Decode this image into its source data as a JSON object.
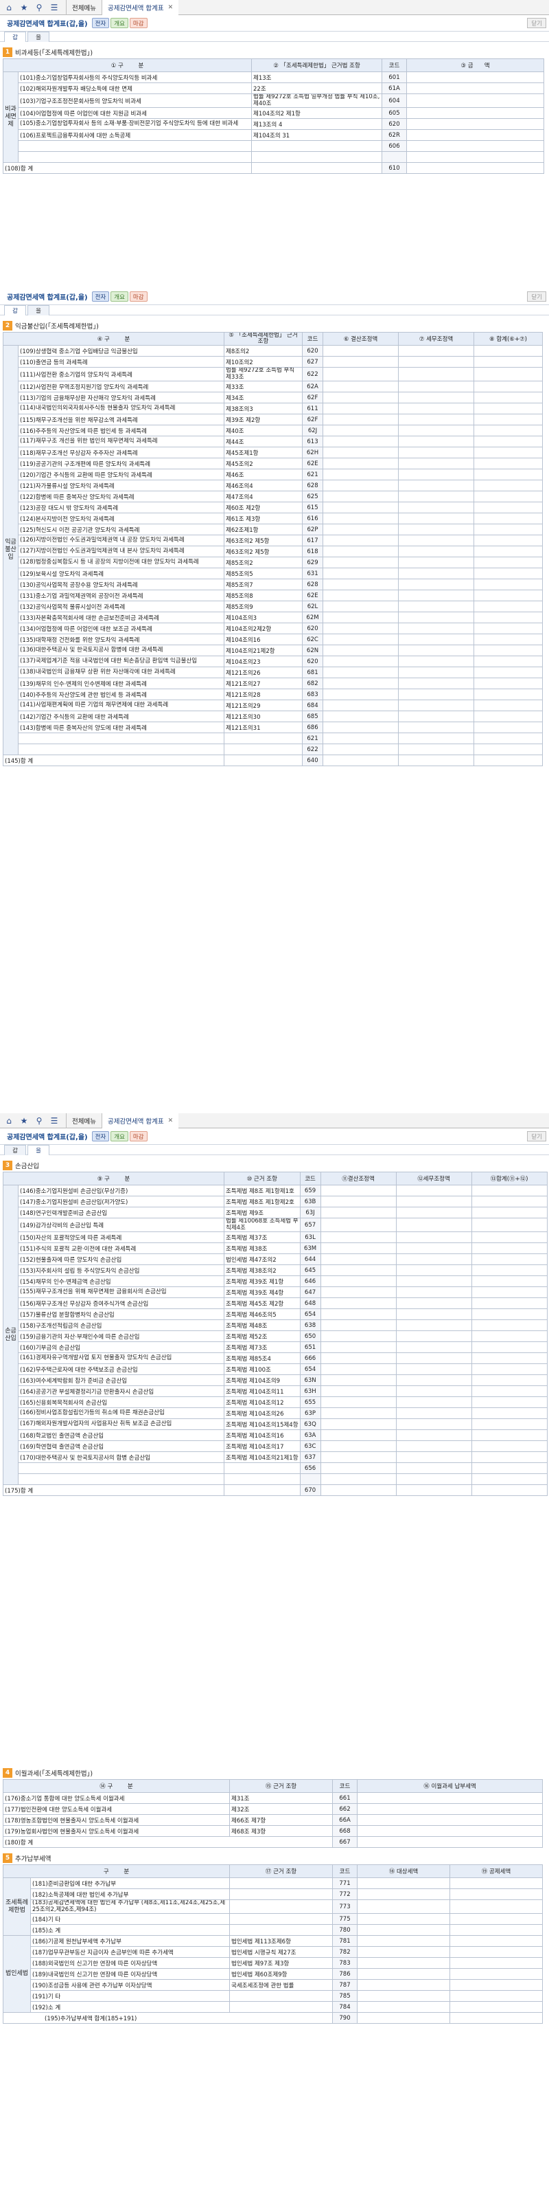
{
  "tabbar": {
    "menu_tab": "전체메뉴",
    "active_tab": "공제감면세액 합계표"
  },
  "form1": {
    "title": "공제감면세액 합계표(갑,을)",
    "btn_print": "전자",
    "btn_open": "개요",
    "btn_close": "마감",
    "btn_exit": "닫기",
    "tab_a": "갑",
    "tab_b": "을",
    "section_no": "1",
    "section_title": "비과세등(「조세특례제한법」)",
    "headers": {
      "gubun": "① 구",
      "gubun2": "분",
      "basis": "② 「조세특례제한법」 근거법 조항",
      "code": "코드",
      "amount": "③ 금",
      "amount2": "액"
    },
    "group": "비과세면제",
    "rows": [
      {
        "name": "(101)중소기업창업투자회사등의 주식양도차익등 비과세",
        "basis": "제13조",
        "code": "601"
      },
      {
        "name": "(102)해외자원개발투자 배당소득에 대한 면제",
        "basis": "22조",
        "code": "61A"
      },
      {
        "name": "(103)기업구조조정전문회사등의 양도차익 비과세",
        "basis": "법률 제9272호 조특법 일부개정 법률 부칙 제10조,제40조",
        "code": "604"
      },
      {
        "name": "(104)어업협정에 따른 어업인에 대한 지원금 비과세",
        "basis": "제104조의2 제1항",
        "code": "605"
      },
      {
        "name": "(105)중소기업창업투자회사 등의 소재·부품·장비전문기업 주식양도차익 등에 대한 비과세",
        "basis": "제13조의 4",
        "code": "620"
      },
      {
        "name": "(106)프로젝트금융투자회사에 대한 소득공제",
        "basis": "제104조의 31",
        "code": "62R"
      },
      {
        "name": "",
        "basis": "",
        "code": "606"
      },
      {
        "name": "",
        "basis": "",
        "code": ""
      }
    ],
    "total": {
      "name": "(108)합      계",
      "code": "610"
    }
  },
  "form2": {
    "section_no": "2",
    "section_title": "익금불산입(「조세특례제한법」)",
    "headers": {
      "gubun": "④ 구",
      "gubun2": "분",
      "basis": "⑤ 「조세특례제한법」 근거 조항",
      "code": "코드",
      "c1": "⑥ 결산조정액",
      "c2": "⑦ 세무조정액",
      "c3": "⑧ 합계(⑥+⑦)"
    },
    "group": "익금불산입",
    "rows": [
      {
        "name": "(109)상생협력 중소기업 수입배당금 익금불산입",
        "basis": "제8조의2",
        "code": "620"
      },
      {
        "name": "(110)출연금 등의 과세특례",
        "basis": "제10조의2",
        "code": "627"
      },
      {
        "name": "(111)사업전환 중소기업의 양도차익 과세특례",
        "basis": "법률 제9272호 조특법 부칙 제33조",
        "code": "622"
      },
      {
        "name": "(112)사업전환 무역조정지원기업 양도차익 과세특례",
        "basis": "제33조",
        "code": "62A"
      },
      {
        "name": "(113)기업의 금융채무상환 자산매각 양도차익 과세특례",
        "basis": "제34조",
        "code": "62F"
      },
      {
        "name": "(114)내국법인의외국자회사주식등 현물출자 양도차익 과세특례",
        "basis": "제38조의3",
        "code": "611"
      },
      {
        "name": "(115)채무구조개선을 위한 채무감소액 과세특례",
        "basis": "제39조 제2항",
        "code": "62F"
      },
      {
        "name": "(116)주주등의 자산양도에 따른 법인세 등 과세특례",
        "basis": "제40조",
        "code": "62J"
      },
      {
        "name": "(117)재무구조 개선을 위한 법인의 채무면제익 과세특례",
        "basis": "제44조",
        "code": "613"
      },
      {
        "name": "(118)재무구조개선 무상감자 주주자산 과세특례",
        "basis": "제45조제1항",
        "code": "62H"
      },
      {
        "name": "(119)공공기관의 구조개편에 따른 양도차익 과세특례",
        "basis": "제45조의2",
        "code": "62E"
      },
      {
        "name": "(120)기업간 주식등의 교환에 따른 양도차익 과세특례",
        "basis": "제46조",
        "code": "621"
      },
      {
        "name": "(121)자가물류시설 양도차익 과세특례",
        "basis": "제46조의4",
        "code": "628"
      },
      {
        "name": "(122)합병에 따른 중복자산 양도차익 과세특례",
        "basis": "제47조의4",
        "code": "625"
      },
      {
        "name": "(123)공장 대도시 밖 양도차익 과세특례",
        "basis": "제60조 제2항",
        "code": "615"
      },
      {
        "name": "(124)본사지방이전 양도차익 과세특례",
        "basis": "제61조 제3항",
        "code": "616"
      },
      {
        "name": "(125)혁신도시 이전 공공기관 양도차익 과세특례",
        "basis": "제62조제1항",
        "code": "62P"
      },
      {
        "name": "(126)지방이전법인 수도권과밀억제권역 내 공장 양도차익 과세특례",
        "basis": "제63조의2 제5항",
        "code": "617"
      },
      {
        "name": "(127)지방이전법인 수도권과밀억제권역 내 본사 양도차익 과세특례",
        "basis": "제63조의2 제5항",
        "code": "618"
      },
      {
        "name": "(128)법정중심복합도시 등 내 공장의 지방이전에 대한 양도차익 과세특례",
        "basis": "제85조의2",
        "code": "629"
      },
      {
        "name": "(129)보육시설 양도차익 과세특례",
        "basis": "제85조의5",
        "code": "631"
      },
      {
        "name": "(130)공익사업목적 공장수용 양도차익 과세특례",
        "basis": "제85조의7",
        "code": "628"
      },
      {
        "name": "(131)중소기업 과밀억제권역외 공장이전 과세특례",
        "basis": "제85조의8",
        "code": "62E"
      },
      {
        "name": "(132)공익사업목적 물류시설이전 과세특례",
        "basis": "제85조의9",
        "code": "62L"
      },
      {
        "name": "(133)자본확충목적회사에 대한 손금보전준비금 과세특례",
        "basis": "제104조의3",
        "code": "62M"
      },
      {
        "name": "(134)어업협정에 따른 어업인에 대한 보조금 과세특례",
        "basis": "제104조의2제2항",
        "code": "620"
      },
      {
        "name": "(135)대학재정 건전화를 위한 양도차익 과세특례",
        "basis": "제104조의16",
        "code": "62C"
      },
      {
        "name": "(136)대한주택공사 및 한국토지공사 합병에 대한 과세특례",
        "basis": "제104조의21제2항",
        "code": "62N"
      },
      {
        "name": "(137)국제업계기준 적용 내국법인에 대한 퇴손충당금 환입액 익금불산입",
        "basis": "제104조의23",
        "code": "620"
      },
      {
        "name": "(138)내국법인의 금융채무 상환 위한 자산매각에 대한 과세특례",
        "basis": "제121조의26",
        "code": "681"
      },
      {
        "name": "(139)채무의 인수·변제의 인수변제에 대한 과세특례",
        "basis": "제121조의27",
        "code": "682"
      },
      {
        "name": "(140)주주등의 자산양도에 관한 법인세 등 과세특례",
        "basis": "제121조의28",
        "code": "683"
      },
      {
        "name": "(141)사업재편계획에 따른 기업의 채무면제에 대한 과세특례",
        "basis": "제121조의29",
        "code": "684"
      },
      {
        "name": "(142)기업간 주식등의 교환에 대한 과세특례",
        "basis": "제121조의30",
        "code": "685"
      },
      {
        "name": "(143)합병에 따른 중복자산의 양도에 대한 과세특례",
        "basis": "제121조의31",
        "code": "686"
      },
      {
        "name": "",
        "basis": "",
        "code": "621"
      },
      {
        "name": "",
        "basis": "",
        "code": "622"
      }
    ],
    "total": {
      "name": "(145)합      계",
      "code": "640"
    }
  },
  "form3": {
    "title": "공제감면세액 합계표(갑,을)",
    "btn_print": "전자",
    "btn_open": "개요",
    "btn_close": "마감",
    "btn_exit": "닫기",
    "tab_a": "갑",
    "tab_b": "을",
    "section_no": "3",
    "section_title": "손금산입",
    "headers": {
      "gubun": "⑨ 구",
      "gubun2": "분",
      "basis": "⑩ 근거 조항",
      "code": "코드",
      "c1": "⑪결산조정액",
      "c2": "⑫세무조정액",
      "c3": "⑬합계(⑪+⑫)"
    },
    "group": "손금산입",
    "rows": [
      {
        "name": "(146)중소기업지원설비 손금산입(무상기증)",
        "basis": "조특제법 제8조 제1항제1호",
        "code": "659"
      },
      {
        "name": "(147)중소기업지원설비 손금산입(저가양도)",
        "basis": "조특제법 제8조 제1항제2호",
        "code": "63B"
      },
      {
        "name": "(148)연구인력개발준비금 손금산입",
        "basis": "조특제법 제9조",
        "code": "63J"
      },
      {
        "name": "(149)감가상각비의 손금산입 특례",
        "basis": "법률 제10068호 조특제법 부칙제4조",
        "code": "657"
      },
      {
        "name": "(150)자산의 포괄적양도에 따른 과세특례",
        "basis": "조특제법 제37조",
        "code": "63L"
      },
      {
        "name": "(151)주식의 포괄적 교환·이전에 대한 과세특례",
        "basis": "조특제법 제38조",
        "code": "63M"
      },
      {
        "name": "(152)현물출자에 따른 양도차익 손금산입",
        "basis": "법인세법 제47조의2",
        "code": "644"
      },
      {
        "name": "(153)지주회사의 설립 등 주식양도차익 손금산입",
        "basis": "조특제법 제38조의2",
        "code": "645"
      },
      {
        "name": "(154)채무의 인수·변제금액 손금산입",
        "basis": "조특제법 제39조 제1항",
        "code": "646"
      },
      {
        "name": "(155)재무구조개선을 위해 채무면제한 금융회사의 손금산입",
        "basis": "조특제법 제39조 제4항",
        "code": "647"
      },
      {
        "name": "(156)재무구조개선 무상감자 증여주식가액 손금산입",
        "basis": "조특제법 제45조 제2항",
        "code": "648"
      },
      {
        "name": "(157)물류산업 분할합병차익 손금산입",
        "basis": "조특제법 제46조의5",
        "code": "654"
      },
      {
        "name": "(158)구조개선적립금의 손금산입",
        "basis": "조특제법 제48조",
        "code": "638"
      },
      {
        "name": "(159)금융기관의 자산·부채인수에 따른 손금산입",
        "basis": "조특제법 제52조",
        "code": "650"
      },
      {
        "name": "(160)기부금의 손금산입",
        "basis": "조특제법 제73조",
        "code": "651"
      },
      {
        "name": "(161)경제자유구역개발사업 토지 현물출자 양도차익 손금산입",
        "basis": "조특제법 제85조4",
        "code": "666"
      },
      {
        "name": "(162)무주택근로자에 대한 주택보조금 손금산입",
        "basis": "조특제법 제100조",
        "code": "654"
      },
      {
        "name": "(163)여수세계박람회 참가 준비금 손금산입",
        "basis": "조특제법 제104조의9",
        "code": "63N"
      },
      {
        "name": "(164)공공기관 부설체결정리기금 반환출자시 손금산입",
        "basis": "조특제법 제104조의11",
        "code": "63H"
      },
      {
        "name": "(165)신용회복목적회사의 손금산입",
        "basis": "조특제법 제104조의12",
        "code": "655"
      },
      {
        "name": "(166)정비사업조합설립인가등의 취소에 따른 채권손금산입",
        "basis": "조특제법 제104조의26",
        "code": "63P"
      },
      {
        "name": "(167)해외자원개발사업자의 사업용자산 취득 보조금 손금산입",
        "basis": "조특제법 제104조의15제4항",
        "code": "63Q"
      },
      {
        "name": "(168)학교법인 출연금액 손금산입",
        "basis": "조특제법 제104조의16",
        "code": "63A"
      },
      {
        "name": "(169)학연협력 출연금액 손금산입",
        "basis": "조특제법 제104조의17",
        "code": "63C"
      },
      {
        "name": "(170)대한주택공사 및 한국토지공사의 합병 손금산입",
        "basis": "조특제법 제104조의21제1항",
        "code": "637"
      },
      {
        "name": "",
        "basis": "",
        "code": "656"
      },
      {
        "name": "",
        "basis": "",
        "code": ""
      }
    ],
    "total": {
      "name": "(175)합      계",
      "code": "670"
    }
  },
  "form4": {
    "section_no": "4",
    "section_title": "이월과세(「조세특례제한법」)",
    "headers": {
      "gubun": "⑭ 구",
      "gubun2": "분",
      "basis": "⑮ 근거 조항",
      "code": "코드",
      "c1": "⑯ 이월과세 납부세액"
    },
    "rows": [
      {
        "name": "(176)중소기업 통합에 대한 양도소득세 이월과세",
        "basis": "제31조",
        "code": "661"
      },
      {
        "name": "(177)법인전환에 대한 양도소득세 이월과세",
        "basis": "제32조",
        "code": "662"
      },
      {
        "name": "(178)영농조합법인에 현물출자시 양도소득세 이월과세",
        "basis": "제66조 제7항",
        "code": "66A"
      },
      {
        "name": "(179)농업회사법인에 현물출자시 양도소득세 이월과세",
        "basis": "제68조 제3항",
        "code": "668"
      }
    ],
    "total": {
      "name": "(180)합      계",
      "code": "667"
    }
  },
  "form5": {
    "section_no": "5",
    "section_title": "추가납부세액",
    "headers": {
      "gubun": "구",
      "gubun2": "분",
      "basis": "⑰ 근거 조항",
      "code": "코드",
      "c1": "⑱ 대상세액",
      "c2": "⑲ 공제세액"
    },
    "group1": "조세특례제한법",
    "group2": "법인세법",
    "rows1": [
      {
        "name": "(181)준비금환입에 대한 추가납부",
        "basis": "",
        "code": "771"
      },
      {
        "name": "(182)소득공제에 대한 법인세 추가납부",
        "basis": "",
        "code": "772"
      },
      {
        "name": "(183)공제감면세액에 대한 법인세 추가납부 (제8조,제11조,제24조,제25조,제25조의2,제26조,제94조)",
        "basis": "",
        "code": "773"
      },
      {
        "name": "(184)기      타",
        "basis": "",
        "code": "775"
      },
      {
        "name": "(185)소      계",
        "basis": "",
        "code": "780"
      }
    ],
    "rows2": [
      {
        "name": "(186)기공제 원천납부세액 추가납부",
        "basis": "법인세법 제113조제6항",
        "code": "781"
      },
      {
        "name": "(187)업무무관부동산 지급이자 손금부인에 따른 추가세액",
        "basis": "법인세법 시행규칙 제27조",
        "code": "782"
      },
      {
        "name": "(188)외국법인의 신고기한 연장에 따른 이자상당액",
        "basis": "법인세법 제97조 제3항",
        "code": "783"
      },
      {
        "name": "(189)내국법인의 신고기한 연장에 따른 이자상당액",
        "basis": "법인세법 제60조제9항",
        "code": "786"
      },
      {
        "name": "(190)조성금등 사용에 관련 추가납부 이자상당액",
        "basis": "국세조세조정에 관한 법률",
        "code": "787"
      },
      {
        "name": "(191)기      타",
        "basis": "",
        "code": "785"
      },
      {
        "name": "(192)소      계",
        "basis": "",
        "code": "784"
      }
    ],
    "total": {
      "name": "(195)추가납부세액 합계(185+191)",
      "code": "790"
    }
  }
}
